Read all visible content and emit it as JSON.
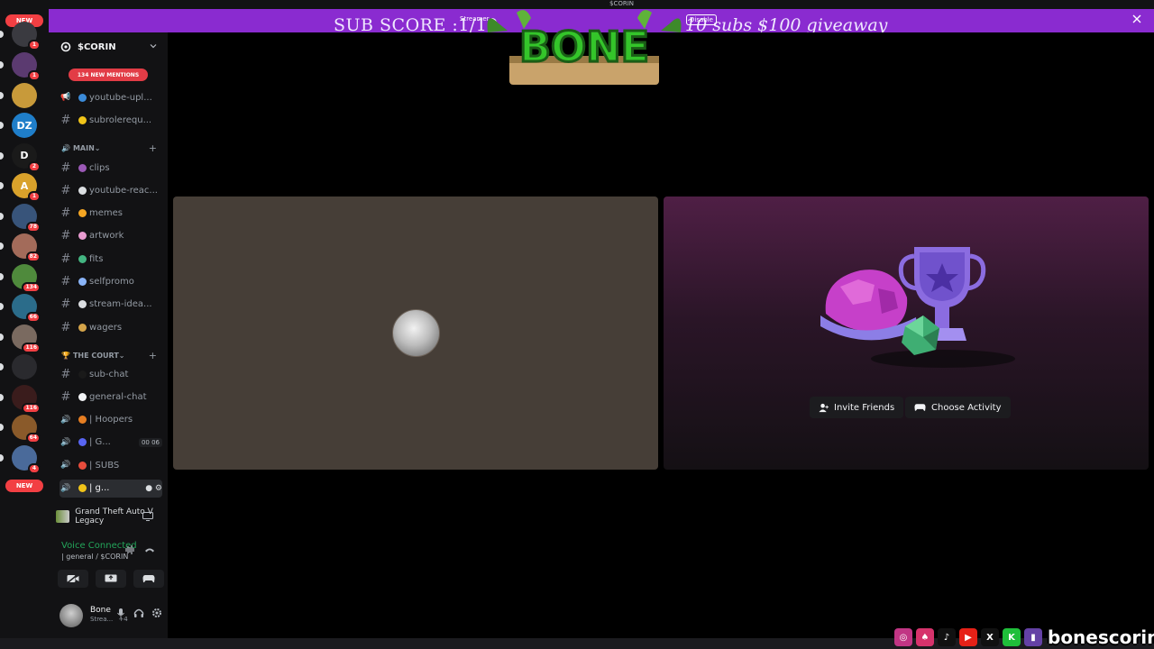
{
  "topbar": {
    "title": "$CORIN"
  },
  "banner": {
    "left_text": "SUB SCORE :1/10",
    "right_text": "10 subs $100 giveaway",
    "small_text": "Streamer",
    "disable_label": "Disable"
  },
  "logo": {
    "text": "BONE"
  },
  "rail": {
    "new_top": "NEW",
    "new_bottom": "NEW",
    "servers": [
      {
        "name": "server-1",
        "badge": "1",
        "color": "#3a3a40",
        "letter": ""
      },
      {
        "name": "server-2",
        "badge": "1",
        "color": "#5b3a70",
        "letter": ""
      },
      {
        "name": "server-3",
        "badge": "",
        "color": "#c89a3a",
        "letter": ""
      },
      {
        "name": "server-dz",
        "badge": "",
        "color": "#1f7ec9",
        "letter": "DZ"
      },
      {
        "name": "server-5",
        "badge": "2",
        "color": "#1a1a1a",
        "letter": "D"
      },
      {
        "name": "server-6",
        "badge": "1",
        "color": "#d9a22b",
        "letter": "A"
      },
      {
        "name": "server-7",
        "badge": "78",
        "color": "#38547a",
        "letter": ""
      },
      {
        "name": "server-8",
        "badge": "82",
        "color": "#a36b5a",
        "letter": ""
      },
      {
        "name": "server-9",
        "badge": "134",
        "color": "#4f8a3c",
        "letter": ""
      },
      {
        "name": "server-10",
        "badge": "66",
        "color": "#2b6c8a",
        "letter": ""
      },
      {
        "name": "server-11",
        "badge": "116",
        "color": "#7a6a60",
        "letter": ""
      },
      {
        "name": "server-12",
        "badge": "",
        "color": "#2a2a2e",
        "letter": ""
      },
      {
        "name": "server-13",
        "badge": "116",
        "color": "#3a1c1c",
        "letter": ""
      },
      {
        "name": "server-14",
        "badge": "64",
        "color": "#8a5a2a",
        "letter": ""
      },
      {
        "name": "server-15",
        "badge": "4",
        "color": "#4a6a9a",
        "letter": ""
      }
    ]
  },
  "sidebar": {
    "server_name": "$CORIN",
    "mentions": "134 NEW MENTIONS",
    "channels_top": [
      {
        "label": "youtube-upl...",
        "dot": "#3b8bd9",
        "type": "announce"
      },
      {
        "label": "subrolerequ...",
        "dot": "#f0c419",
        "type": "text"
      }
    ],
    "cat_main": "MAIN",
    "channels_main": [
      {
        "label": "clips",
        "dot": "#9b59b6"
      },
      {
        "label": "youtube-reac...",
        "dot": "#dbdee1"
      },
      {
        "label": "memes",
        "dot": "#f5a623"
      },
      {
        "label": "artwork",
        "dot": "#e89bd0"
      },
      {
        "label": "fits",
        "dot": "#43b581"
      },
      {
        "label": "selfpromo",
        "dot": "#8ab4f8"
      },
      {
        "label": "stream-idea...",
        "dot": "#dbdee1"
      },
      {
        "label": "wagers",
        "dot": "#d4a44a"
      }
    ],
    "cat_court": "THE COURT",
    "channels_court": [
      {
        "label": "sub-chat",
        "dot": "#1a1a1a",
        "type": "text"
      },
      {
        "label": "general-chat",
        "dot": "#f2f3f5",
        "type": "text"
      },
      {
        "label": "| Hoopers",
        "dot": "#e67e22",
        "type": "voice"
      },
      {
        "label": "| G...",
        "dot": "#5865f2",
        "type": "voice",
        "count": "00 06"
      },
      {
        "label": "| SUBS",
        "dot": "#e74c3c",
        "type": "voice"
      },
      {
        "label": "| g...",
        "dot": "#f0c419",
        "type": "voice",
        "active": true
      }
    ]
  },
  "activity": {
    "game": "Grand Theft Auto V Legacy"
  },
  "voice": {
    "status": "Voice Connected",
    "channel": "| general / $CORIN"
  },
  "user": {
    "name": "Bone",
    "status": "Strea...",
    "extra": "+4"
  },
  "tiles": {
    "invite_label": "Invite Friends",
    "activity_label": "Choose Activity"
  },
  "socials": {
    "handle": "bonescorin"
  },
  "colors": {
    "accent": "#8a2bd0",
    "green": "#23a55a",
    "red": "#f23f43"
  }
}
